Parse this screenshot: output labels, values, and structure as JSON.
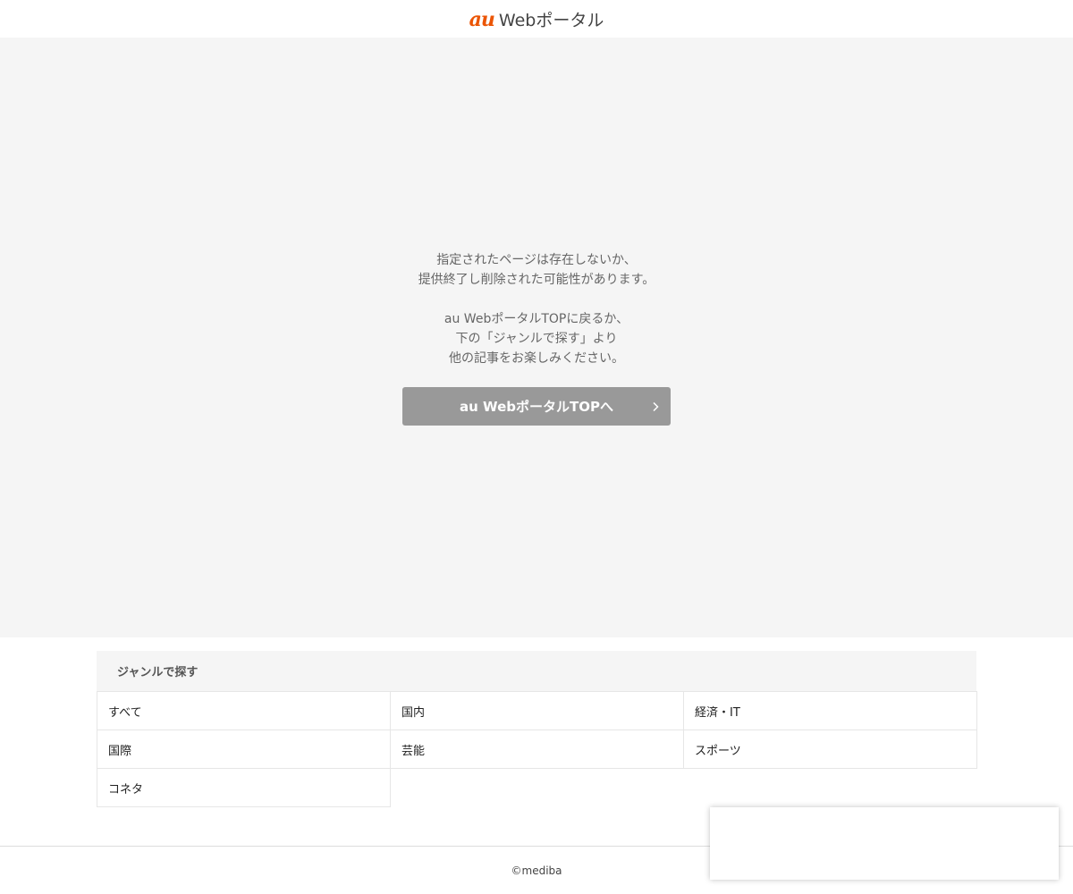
{
  "header": {
    "logo_mark": "au",
    "logo_text": "Webポータル"
  },
  "main": {
    "message_lines_1": [
      "指定されたページは存在しないか、",
      "提供終了し削除された可能性があります。"
    ],
    "message_lines_2": [
      "au WebポータルTOPに戻るか、",
      "下の「ジャンルで探す」より",
      "他の記事をお楽しみください。"
    ],
    "top_button_label": "au WebポータルTOPへ"
  },
  "genre": {
    "title": "ジャンルで探す",
    "items": [
      {
        "label": "すべて"
      },
      {
        "label": "国内"
      },
      {
        "label": "経済・IT"
      },
      {
        "label": "国際"
      },
      {
        "label": "芸能"
      },
      {
        "label": "スポーツ"
      },
      {
        "label": "コネタ"
      }
    ]
  },
  "footer": {
    "copyright": "©mediba"
  },
  "colors": {
    "brand": "#eb5505",
    "button": "#999999",
    "main_bg": "#f5f5f5"
  },
  "icons": {
    "button_arrow": "chevron-right-icon"
  }
}
